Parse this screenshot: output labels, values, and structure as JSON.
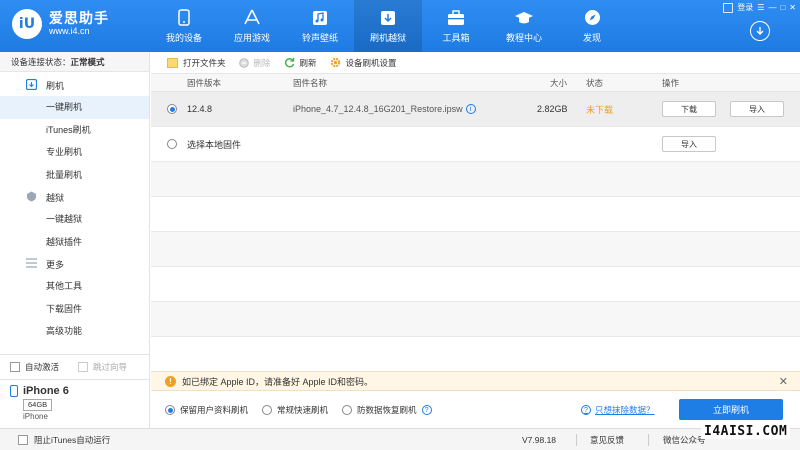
{
  "app": {
    "logo_text": "iU",
    "name": "爱思助手",
    "url": "www.i4.cn"
  },
  "window_controls": {
    "login": "登录"
  },
  "nav": [
    {
      "label": "我的设备",
      "icon": "phone-icon"
    },
    {
      "label": "应用游戏",
      "icon": "app-store-icon"
    },
    {
      "label": "铃声壁纸",
      "icon": "music-icon"
    },
    {
      "label": "刷机越狱",
      "icon": "flash-box-icon",
      "active": true
    },
    {
      "label": "工具箱",
      "icon": "toolbox-icon"
    },
    {
      "label": "教程中心",
      "icon": "graduation-cap-icon"
    },
    {
      "label": "发现",
      "icon": "compass-icon"
    }
  ],
  "sidebar": {
    "conn_label": "设备连接状态：",
    "conn_value": "正常模式",
    "groups": [
      {
        "label": "刷机",
        "items": [
          "一键刷机",
          "iTunes刷机",
          "专业刷机",
          "批量刷机"
        ]
      },
      {
        "label": "越狱",
        "items": [
          "一键越狱",
          "越狱插件"
        ]
      },
      {
        "label": "更多",
        "items": [
          "其他工具",
          "下载固件",
          "高级功能"
        ]
      }
    ],
    "auto_activate": "自动激活",
    "skip_wizard": "跳过向导",
    "device": {
      "name": "iPhone 6",
      "capacity": "64GB",
      "type": "iPhone"
    }
  },
  "toolbar": {
    "open_folder": "打开文件夹",
    "delete": "删除",
    "refresh": "刷新",
    "settings": "设备刷机设置"
  },
  "table": {
    "headers": {
      "version": "固件版本",
      "name": "固件名称",
      "size": "大小",
      "status": "状态",
      "action": "操作"
    },
    "rows": [
      {
        "version": "12.4.8",
        "name": "iPhone_4.7_12.4.8_16G201_Restore.ipsw",
        "size": "2.82GB",
        "status": "未下载",
        "download": "下载",
        "import": "导入"
      }
    ],
    "local": {
      "label": "选择本地固件",
      "import": "导入"
    }
  },
  "notice": "如已绑定 Apple ID，请准备好 Apple ID和密码。",
  "options": {
    "keep_data": "保留用户资料刷机",
    "quick": "常规快速刷机",
    "recovery": "防数据恢复刷机",
    "erase_link": "只想抹除数据？",
    "flash_button": "立即刷机"
  },
  "statusbar": {
    "block_itunes": "阻止iTunes自动运行",
    "version": "V7.98.18",
    "feedback": "意见反馈",
    "wechat": "微信公众号"
  },
  "watermark": "I4AISI.COM",
  "colors": {
    "primary": "#1f7de6",
    "status_not_downloaded": "#f0a020",
    "notice_bg": "#fff6e5"
  }
}
